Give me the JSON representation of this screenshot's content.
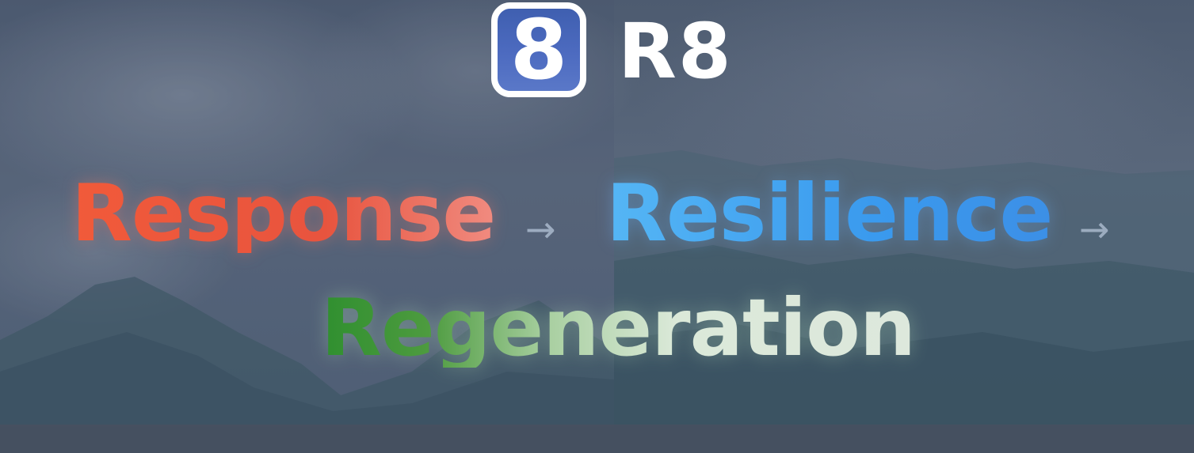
{
  "brand": {
    "logo_digit": "8",
    "name": "R8",
    "logo_icon": "rounded-square-eight-logo"
  },
  "tagline": {
    "words": [
      "Response",
      "Resilience",
      "Regeneration"
    ],
    "separator": "→"
  },
  "colors": {
    "response": "#f15a3a",
    "resilience": "#3a9aee",
    "regeneration_start": "#2f8f2f",
    "regeneration_end": "#dde8dc",
    "logo_fill": "#4d6bc0",
    "bottom_bar": "#465060"
  }
}
